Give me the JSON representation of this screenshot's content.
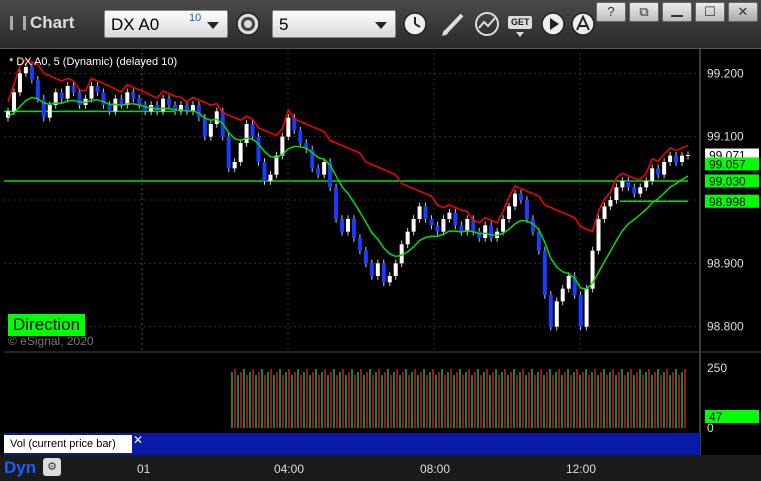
{
  "app": {
    "title": "Chart"
  },
  "toolbar": {
    "symbol": "DX A0",
    "symbol_count": "10",
    "interval": "5",
    "icons": [
      "gear-icon",
      "clock-icon",
      "pencil-icon",
      "line-chart-icon",
      "get-icon",
      "play-icon",
      "alert-icon"
    ],
    "get_label": "GET"
  },
  "window_controls": {
    "help": "?",
    "restore": "⧉",
    "maximize": "☐",
    "close": "✕"
  },
  "legend": "* DX A0, 5 (Dynamic) (delayed 10)",
  "study_label": "Direction",
  "copyright": "© eSignal, 2020",
  "price_axis": {
    "ticks": [
      "99.200",
      "99.100",
      "99.000",
      "98.900",
      "98.800"
    ],
    "ticks_values": [
      99.2,
      99.1,
      99.0,
      98.9,
      98.8
    ],
    "markers": [
      {
        "label": "99.071",
        "value": 99.071,
        "bg": "#ffffff",
        "fg": "#000000"
      },
      {
        "label": "99.057",
        "value": 99.057,
        "bg": "#00ff00",
        "fg": "#000000"
      },
      {
        "label": "99.030",
        "value": 99.03,
        "bg": "#00ff00",
        "fg": "#000000"
      },
      {
        "label": "98.998",
        "value": 98.998,
        "bg": "#00ff00",
        "fg": "#000000"
      }
    ]
  },
  "volume_axis": {
    "ticks": [
      "250",
      "0"
    ],
    "marker": {
      "label": "47",
      "bg": "#00ff00"
    }
  },
  "volume_label": "Vol (current price bar)",
  "volume_close": "✕",
  "bottom": {
    "mode": "Dyn"
  },
  "time_axis": [
    "01",
    "04:00",
    "08:00",
    "12:00"
  ],
  "colors": {
    "up_candle": "#ffffff",
    "down_candle": "#1a3cff",
    "red_line": "#ff0000",
    "green_line": "#00e000",
    "grid": "#303030"
  },
  "chart_data": {
    "type": "candlestick",
    "ylim": [
      98.76,
      99.24
    ],
    "horizontal_levels": [
      99.03,
      98.998
    ],
    "closes": [
      99.14,
      99.17,
      99.2,
      99.21,
      99.19,
      99.16,
      99.13,
      99.15,
      99.17,
      99.16,
      99.18,
      99.17,
      99.15,
      99.16,
      99.18,
      99.17,
      99.15,
      99.14,
      99.16,
      99.15,
      99.17,
      99.16,
      99.15,
      99.14,
      99.15,
      99.14,
      99.16,
      99.15,
      99.14,
      99.15,
      99.14,
      99.15,
      99.13,
      99.1,
      99.12,
      99.14,
      99.1,
      99.05,
      99.06,
      99.09,
      99.12,
      99.1,
      99.06,
      99.03,
      99.04,
      99.07,
      99.1,
      99.13,
      99.11,
      99.09,
      99.08,
      99.05,
      99.04,
      99.06,
      99.02,
      98.97,
      98.95,
      98.97,
      98.94,
      98.92,
      98.9,
      98.88,
      98.9,
      98.87,
      98.88,
      98.9,
      98.93,
      98.95,
      98.97,
      98.99,
      98.97,
      98.96,
      98.95,
      98.97,
      98.98,
      98.96,
      98.95,
      98.97,
      98.95,
      98.94,
      98.96,
      98.94,
      98.95,
      98.97,
      98.99,
      99.01,
      99.0,
      98.97,
      98.95,
      98.92,
      98.85,
      98.8,
      98.84,
      98.86,
      98.88,
      98.85,
      98.8,
      98.86,
      98.92,
      98.97,
      98.99,
      99.0,
      99.02,
      99.03,
      99.02,
      99.01,
      99.02,
      99.03,
      99.05,
      99.04,
      99.06,
      99.07,
      99.06,
      99.07,
      99.071
    ]
  }
}
